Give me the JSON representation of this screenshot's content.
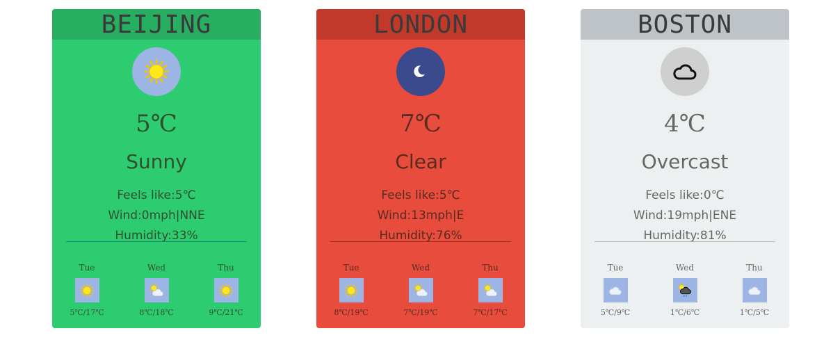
{
  "cities": [
    {
      "name": "BEIJING",
      "temp": "5℃",
      "condition": "Sunny",
      "feels_like": "Feels like:5℃",
      "wind": "Wind:0mph|NNE",
      "humidity": "Humidity:33%",
      "icon": "sun-icon",
      "colors": {
        "header": "#27ae60",
        "body": "#2ecc71",
        "icon_bg": "#9db5e4",
        "text": "#2f4f2f",
        "separator": "#1a8a7a"
      },
      "forecast": [
        {
          "day": "Tue",
          "range": "5℃/17℃",
          "icon": "sun-icon"
        },
        {
          "day": "Wed",
          "range": "8℃/18℃",
          "icon": "partly-cloudy-icon"
        },
        {
          "day": "Thu",
          "range": "9℃/21℃",
          "icon": "sun-icon"
        }
      ]
    },
    {
      "name": "LONDON",
      "temp": "7℃",
      "condition": "Clear",
      "feels_like": "Feels like:5℃",
      "wind": "Wind:13mph|E",
      "humidity": "Humidity:76%",
      "icon": "moon-icon",
      "colors": {
        "header": "#c0392b",
        "body": "#e74c3c",
        "icon_bg": "#3a4a8c",
        "text": "#5a2a20",
        "separator": "#9a3028"
      },
      "forecast": [
        {
          "day": "Tue",
          "range": "8℃/19℃",
          "icon": "sun-icon"
        },
        {
          "day": "Wed",
          "range": "7℃/19℃",
          "icon": "partly-cloudy-icon"
        },
        {
          "day": "Thu",
          "range": "7℃/17℃",
          "icon": "partly-cloudy-icon"
        }
      ]
    },
    {
      "name": "BOSTON",
      "temp": "4℃",
      "condition": "Overcast",
      "feels_like": "Feels like:0℃",
      "wind": "Wind:19mph|ENE",
      "humidity": "Humidity:81%",
      "icon": "cloud-icon",
      "colors": {
        "header": "#bdc3c7",
        "body": "#ecf0f1",
        "icon_bg": "#cfcfcf",
        "text": "#666666",
        "separator": "#b8b8b8"
      },
      "forecast": [
        {
          "day": "Tue",
          "range": "5℃/9℃",
          "icon": "cloud-icon"
        },
        {
          "day": "Wed",
          "range": "1℃/6℃",
          "icon": "rain-cloud-icon"
        },
        {
          "day": "Thu",
          "range": "1℃/5℃",
          "icon": "cloud-icon"
        }
      ]
    }
  ]
}
